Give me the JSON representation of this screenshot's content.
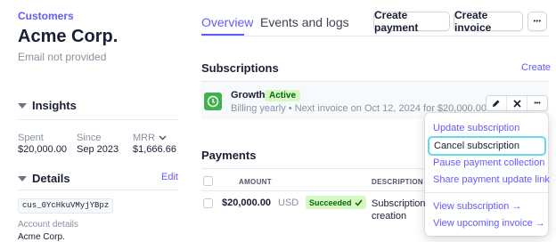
{
  "breadcrumb": "Customers",
  "customer": {
    "name": "Acme Corp.",
    "email": "Email not provided"
  },
  "insights": {
    "title": "Insights",
    "spent_label": "Spent",
    "spent_value": "$20,000.00",
    "since_label": "Since",
    "since_value": "Sep 2023",
    "mrr_label": "MRR",
    "mrr_value": "$1,666.66"
  },
  "details": {
    "title": "Details",
    "edit_label": "Edit",
    "customer_id": "cus_0YcHkuVMyjYBpz",
    "account_label": "Account details",
    "account_value": "Acme Corp."
  },
  "tabs": [
    "Overview",
    "Events and logs"
  ],
  "header_buttons": {
    "create_payment": "Create payment",
    "create_invoice": "Create invoice",
    "more": "•••"
  },
  "subscriptions": {
    "title": "Subscriptions",
    "create_label": "Create",
    "item": {
      "name": "Growth",
      "status": "Active",
      "detail": "Billing yearly • Next invoice on Oct 12, 2024 for $20,000.00"
    }
  },
  "payments": {
    "title": "Payments",
    "columns": [
      "AMOUNT",
      "DESCRIPTION"
    ],
    "row": {
      "amount": "$20,000.00",
      "currency": "USD",
      "status": "Succeeded",
      "description_line1": "Subscription",
      "description_line2": "creation"
    }
  },
  "menu": {
    "items": [
      "Update subscription",
      "Cancel subscription",
      "Pause payment collection",
      "Share payment update link",
      "View subscription →",
      "View upcoming invoice →"
    ]
  },
  "colors": {
    "accent": "#635bff",
    "success": "#2e9e43",
    "success_bg": "#d7f7c2",
    "focus": "#66d9e8"
  }
}
